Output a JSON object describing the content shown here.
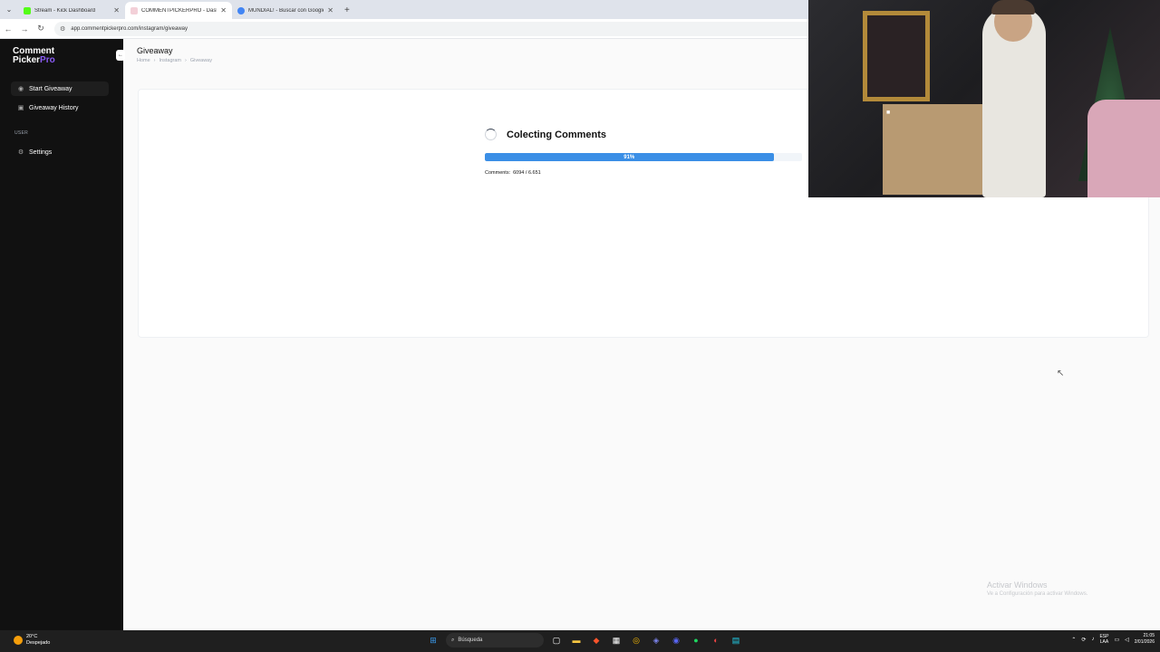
{
  "browser": {
    "tabs": [
      {
        "title": "Stream - Kick Dashboard",
        "active": false,
        "color": "#53fc18"
      },
      {
        "title": "COMMENTPICKERPRO - Dashb",
        "active": true,
        "color": "#f3d0d8"
      },
      {
        "title": "MUNDIAL! - Buscar con Google",
        "active": false,
        "color": "#4285f4"
      }
    ],
    "url": "app.commentpickerpro.com/instagram/giveaway"
  },
  "sidebar": {
    "logo_line1": "Comment",
    "logo_line2a": "Picker",
    "logo_line2b": "Pro",
    "items": [
      {
        "label": "Start Giveaway",
        "icon": "circle-dot-icon",
        "active": true
      },
      {
        "label": "Giveaway History",
        "icon": "history-icon",
        "active": false
      }
    ],
    "section_label": "USER",
    "settings_label": "Settings"
  },
  "page": {
    "title": "Giveaway",
    "breadcrumb": [
      "Home",
      "Instagram",
      "Giveaway"
    ]
  },
  "collecting": {
    "title": "Colecting Comments",
    "progress_label": "91%",
    "progress_value": 0.91,
    "counts_prefix": "Comments:",
    "counts_value": "6094 / 6.651"
  },
  "watermark": {
    "line1": "Activar Windows",
    "line2": "Ve a Configuración para activar Windows."
  },
  "taskbar": {
    "weather_temp": "20°C",
    "weather_desc": "Despejado",
    "search_placeholder": "Búsqueda",
    "lang_line1": "ESP",
    "lang_line2": "LAA",
    "time": "21:05",
    "date": "2/01/2026"
  },
  "colors": {
    "accent": "#3b8fe6",
    "brand_purple": "#8b5cf6",
    "sidebar_bg": "#111111"
  }
}
